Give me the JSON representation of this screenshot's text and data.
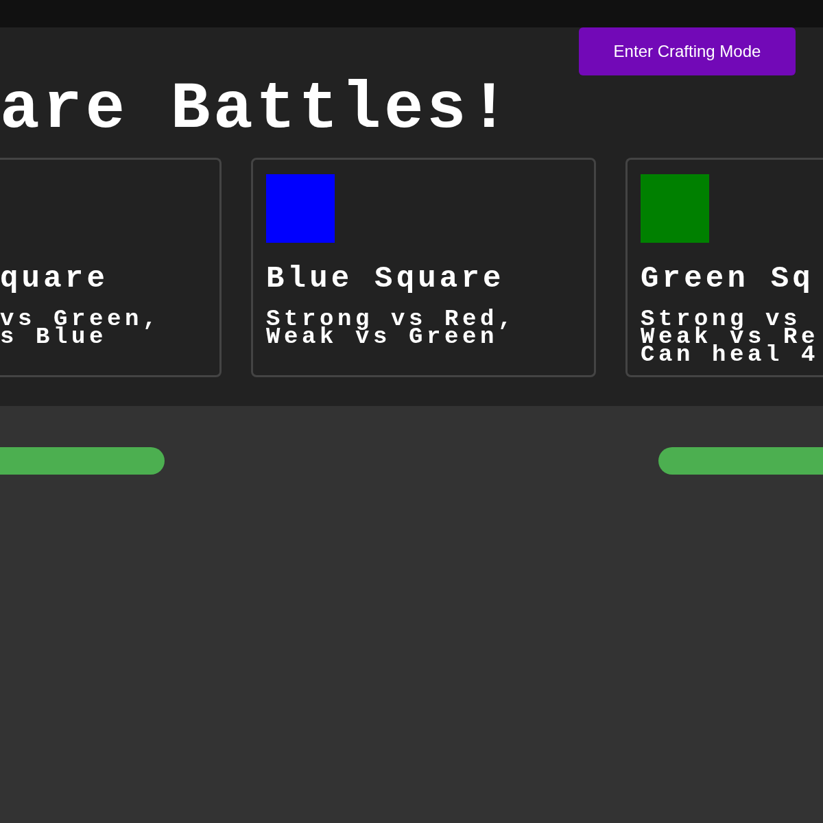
{
  "header": {
    "button": "Enter Crafting Mode",
    "title": "are Battles!"
  },
  "cards": [
    {
      "name": "quare",
      "lines": [
        "vs Green,",
        "s Blue"
      ]
    },
    {
      "name": "Blue Square",
      "color": "#0000ff",
      "lines": [
        "Strong vs Red,",
        "Weak vs Green"
      ]
    },
    {
      "name": "Green Sq",
      "color": "#008000",
      "lines": [
        "Strong vs",
        "Weak vs Re",
        "Can heal 4"
      ]
    }
  ]
}
